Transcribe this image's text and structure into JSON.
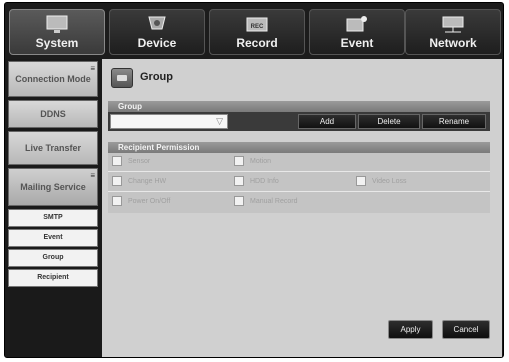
{
  "tabs": [
    {
      "label": "System",
      "icon": "monitor-icon",
      "active": true
    },
    {
      "label": "Device",
      "icon": "camera-icon",
      "active": false
    },
    {
      "label": "Record",
      "icon": "rec-icon",
      "active": false
    },
    {
      "label": "Event",
      "icon": "event-icon",
      "active": false
    },
    {
      "label": "Network",
      "icon": "network-icon",
      "active": false
    }
  ],
  "sidebar": {
    "items": [
      {
        "label": "Connection Mode"
      },
      {
        "label": "DDNS"
      },
      {
        "label": "Live Transfer"
      },
      {
        "label": "Mailing Service"
      }
    ],
    "sub_items": [
      {
        "label": "SMTP"
      },
      {
        "label": "Event"
      },
      {
        "label": "Group"
      },
      {
        "label": "Recipient"
      }
    ]
  },
  "page": {
    "title": "Group"
  },
  "group": {
    "header": "Group",
    "select_value": "",
    "buttons": {
      "add": "Add",
      "delete": "Delete",
      "rename": "Rename"
    }
  },
  "permissions": {
    "header": "Recipient Permission",
    "items": [
      {
        "label": "Sensor"
      },
      {
        "label": "Motion"
      },
      {
        "label": "Change HW"
      },
      {
        "label": "HDD Info"
      },
      {
        "label": "Video Loss"
      },
      {
        "label": "Power On/Off"
      },
      {
        "label": "Manual Record"
      }
    ]
  },
  "footer": {
    "apply": "Apply",
    "cancel": "Cancel"
  },
  "colors": {
    "accent": "#3a3a3a",
    "panel": "#d0d0d0",
    "frame": "#1a1a1a"
  }
}
